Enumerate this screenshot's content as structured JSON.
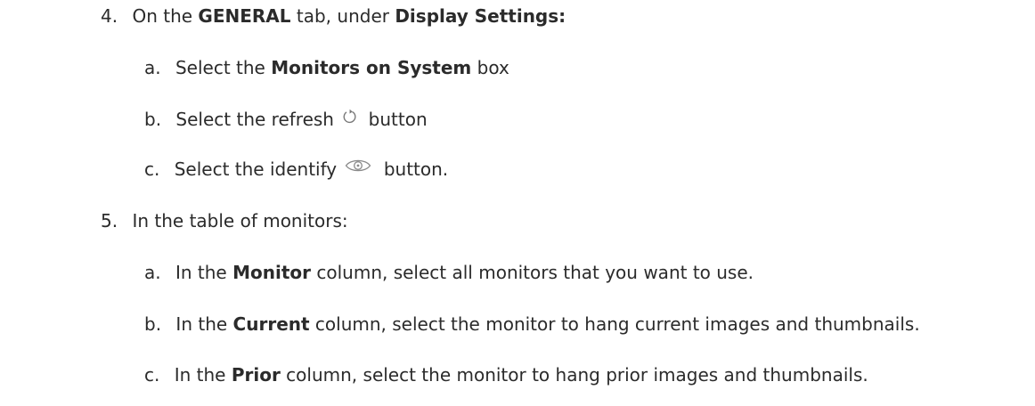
{
  "steps": [
    {
      "number": "4.",
      "text": {
        "p1": "On the ",
        "b1": "GENERAL",
        "p2": " tab, under ",
        "b2": "Display Settings:"
      },
      "substeps": [
        {
          "letter": "a.",
          "p1": "Select the ",
          "b1": "Monitors on System",
          "p2": " box"
        },
        {
          "letter": "b.",
          "p1": "Select the refresh ",
          "icon": "refresh-icon",
          "p2": " button"
        },
        {
          "letter": "c.",
          "p1": "Select the identify ",
          "icon": "eye-icon",
          "p2": " button."
        }
      ]
    },
    {
      "number": "5.",
      "text": {
        "p1": "In the table of monitors:"
      },
      "substeps": [
        {
          "letter": "a.",
          "p1": "In the ",
          "b1": "Monitor",
          "p2": " column, select all monitors that you want to use."
        },
        {
          "letter": "b.",
          "p1": "In the ",
          "b1": "Current",
          "p2": " column, select the monitor to hang current images and thumbnails."
        },
        {
          "letter": "c.",
          "p1": "In the ",
          "b1": "Prior",
          "p2": " column, select the monitor to hang prior images and thumbnails."
        }
      ]
    }
  ]
}
